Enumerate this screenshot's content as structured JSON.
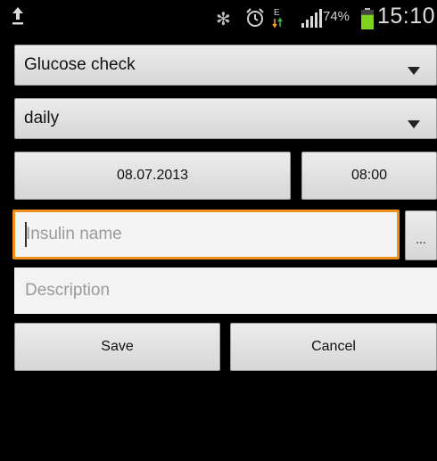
{
  "status_bar": {
    "battery_percent": "74%",
    "time": "15:10",
    "data_indicator": "E",
    "icons": [
      "upload-icon",
      "bluetooth-icon",
      "alarm-icon",
      "data-activity-icon",
      "signal-icon",
      "battery-icon"
    ],
    "battery_level": 0.74,
    "battery_color": "#7ed321"
  },
  "form": {
    "type_spinner": {
      "value": "Glucose check"
    },
    "frequency_spinner": {
      "value": "daily"
    },
    "date_button": "08.07.2013",
    "time_button": "08:00",
    "insulin_name": {
      "placeholder": "Insulin name",
      "value": ""
    },
    "more_button": "...",
    "description": {
      "placeholder": "Description",
      "value": ""
    },
    "save_label": "Save",
    "cancel_label": "Cancel"
  },
  "colors": {
    "focus_border": "#f0901e",
    "background": "#000000"
  }
}
